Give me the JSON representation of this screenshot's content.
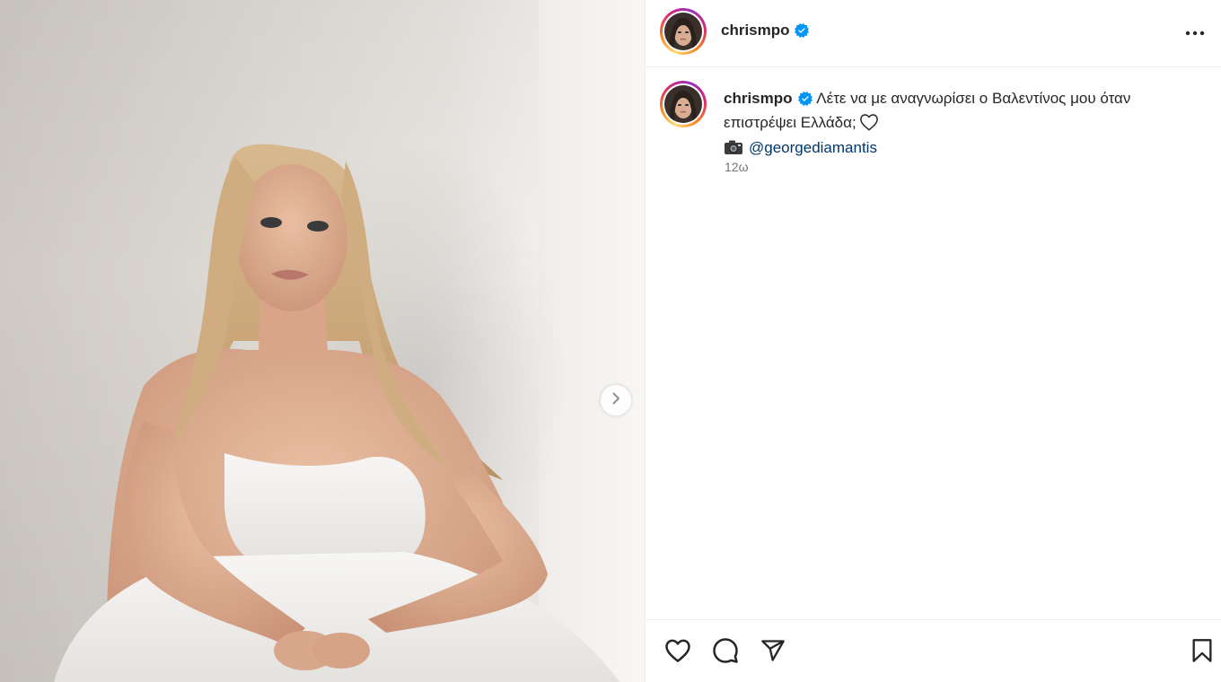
{
  "post": {
    "username": "chrismpo",
    "caption_text": "Λέτε να με αναγνωρίσει ο Βαλεντίνος μου όταν επιστρέψει Ελλάδα;",
    "credit_mention": "@georgediamantis",
    "time_ago": "12ω"
  },
  "icons": {
    "verified": "verified-badge-icon",
    "more": "more-options-icon",
    "heart_emoji": "white-heart-emoji",
    "camera_emoji": "camera-emoji",
    "next": "chevron-right-icon",
    "like": "heart-outline-icon",
    "comment": "comment-bubble-icon",
    "share": "paper-plane-icon",
    "save": "bookmark-icon"
  },
  "colors": {
    "verified_blue": "#0095f6",
    "mention_link": "#00376b",
    "timestamp_gray": "#737373",
    "story_ring": [
      "#feda75",
      "#fa7e1e",
      "#d62976",
      "#962fbf"
    ]
  }
}
